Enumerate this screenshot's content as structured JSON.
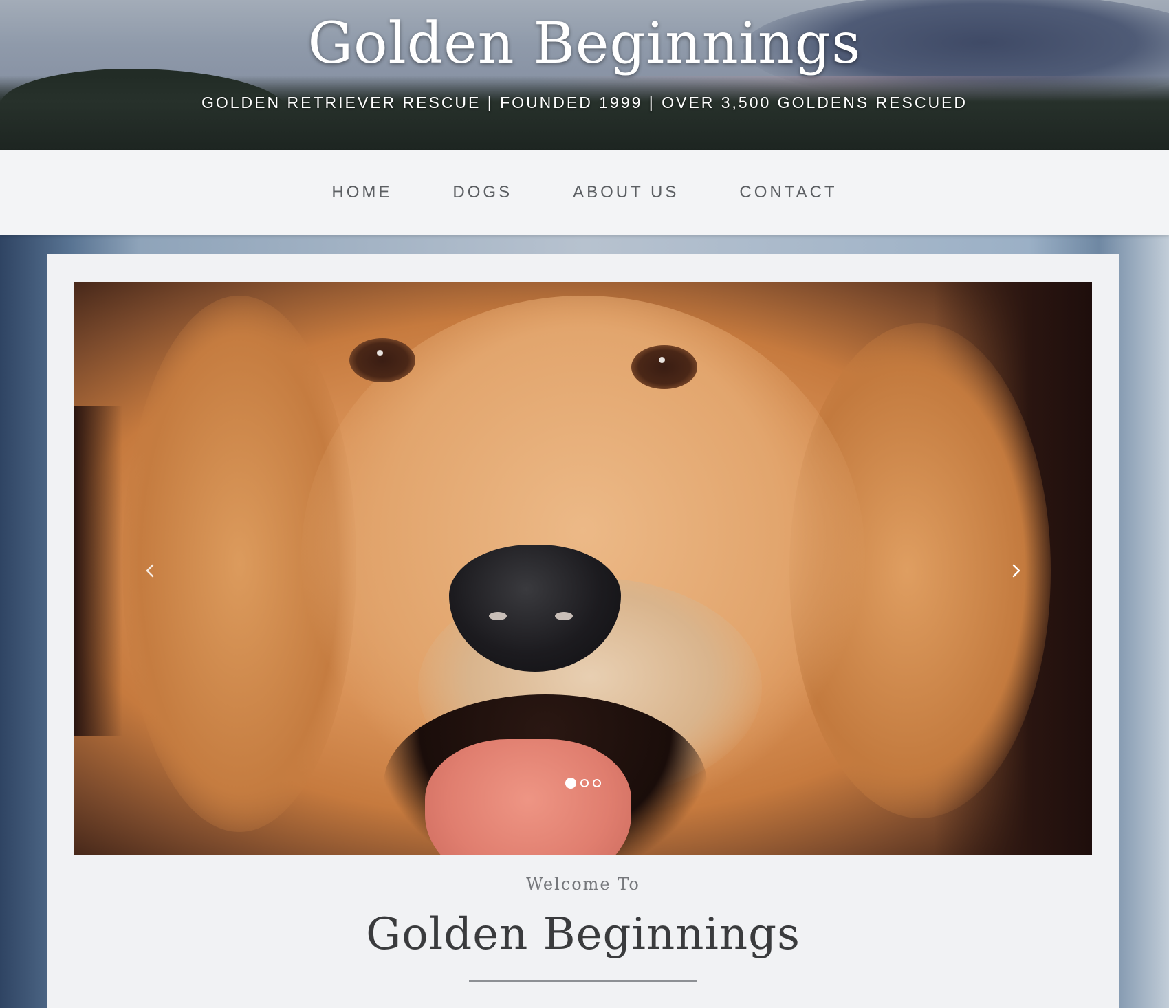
{
  "header": {
    "title": "Golden Beginnings",
    "tagline": "GOLDEN RETRIEVER RESCUE | FOUNDED 1999 | OVER 3,500 GOLDENS RESCUED"
  },
  "nav": {
    "items": [
      {
        "label": "HOME"
      },
      {
        "label": "DOGS"
      },
      {
        "label": "ABOUT US"
      },
      {
        "label": "CONTACT"
      }
    ]
  },
  "slider": {
    "slide_count": 3,
    "active_slide": 1,
    "prev_icon": "chevron-left-icon",
    "next_icon": "chevron-right-icon"
  },
  "main": {
    "welcome": "Welcome To",
    "heading": "Golden Beginnings"
  },
  "colors": {
    "nav_bg": "#f3f4f6",
    "nav_text": "#5c5f63",
    "heading_text": "#3a3b3d"
  }
}
